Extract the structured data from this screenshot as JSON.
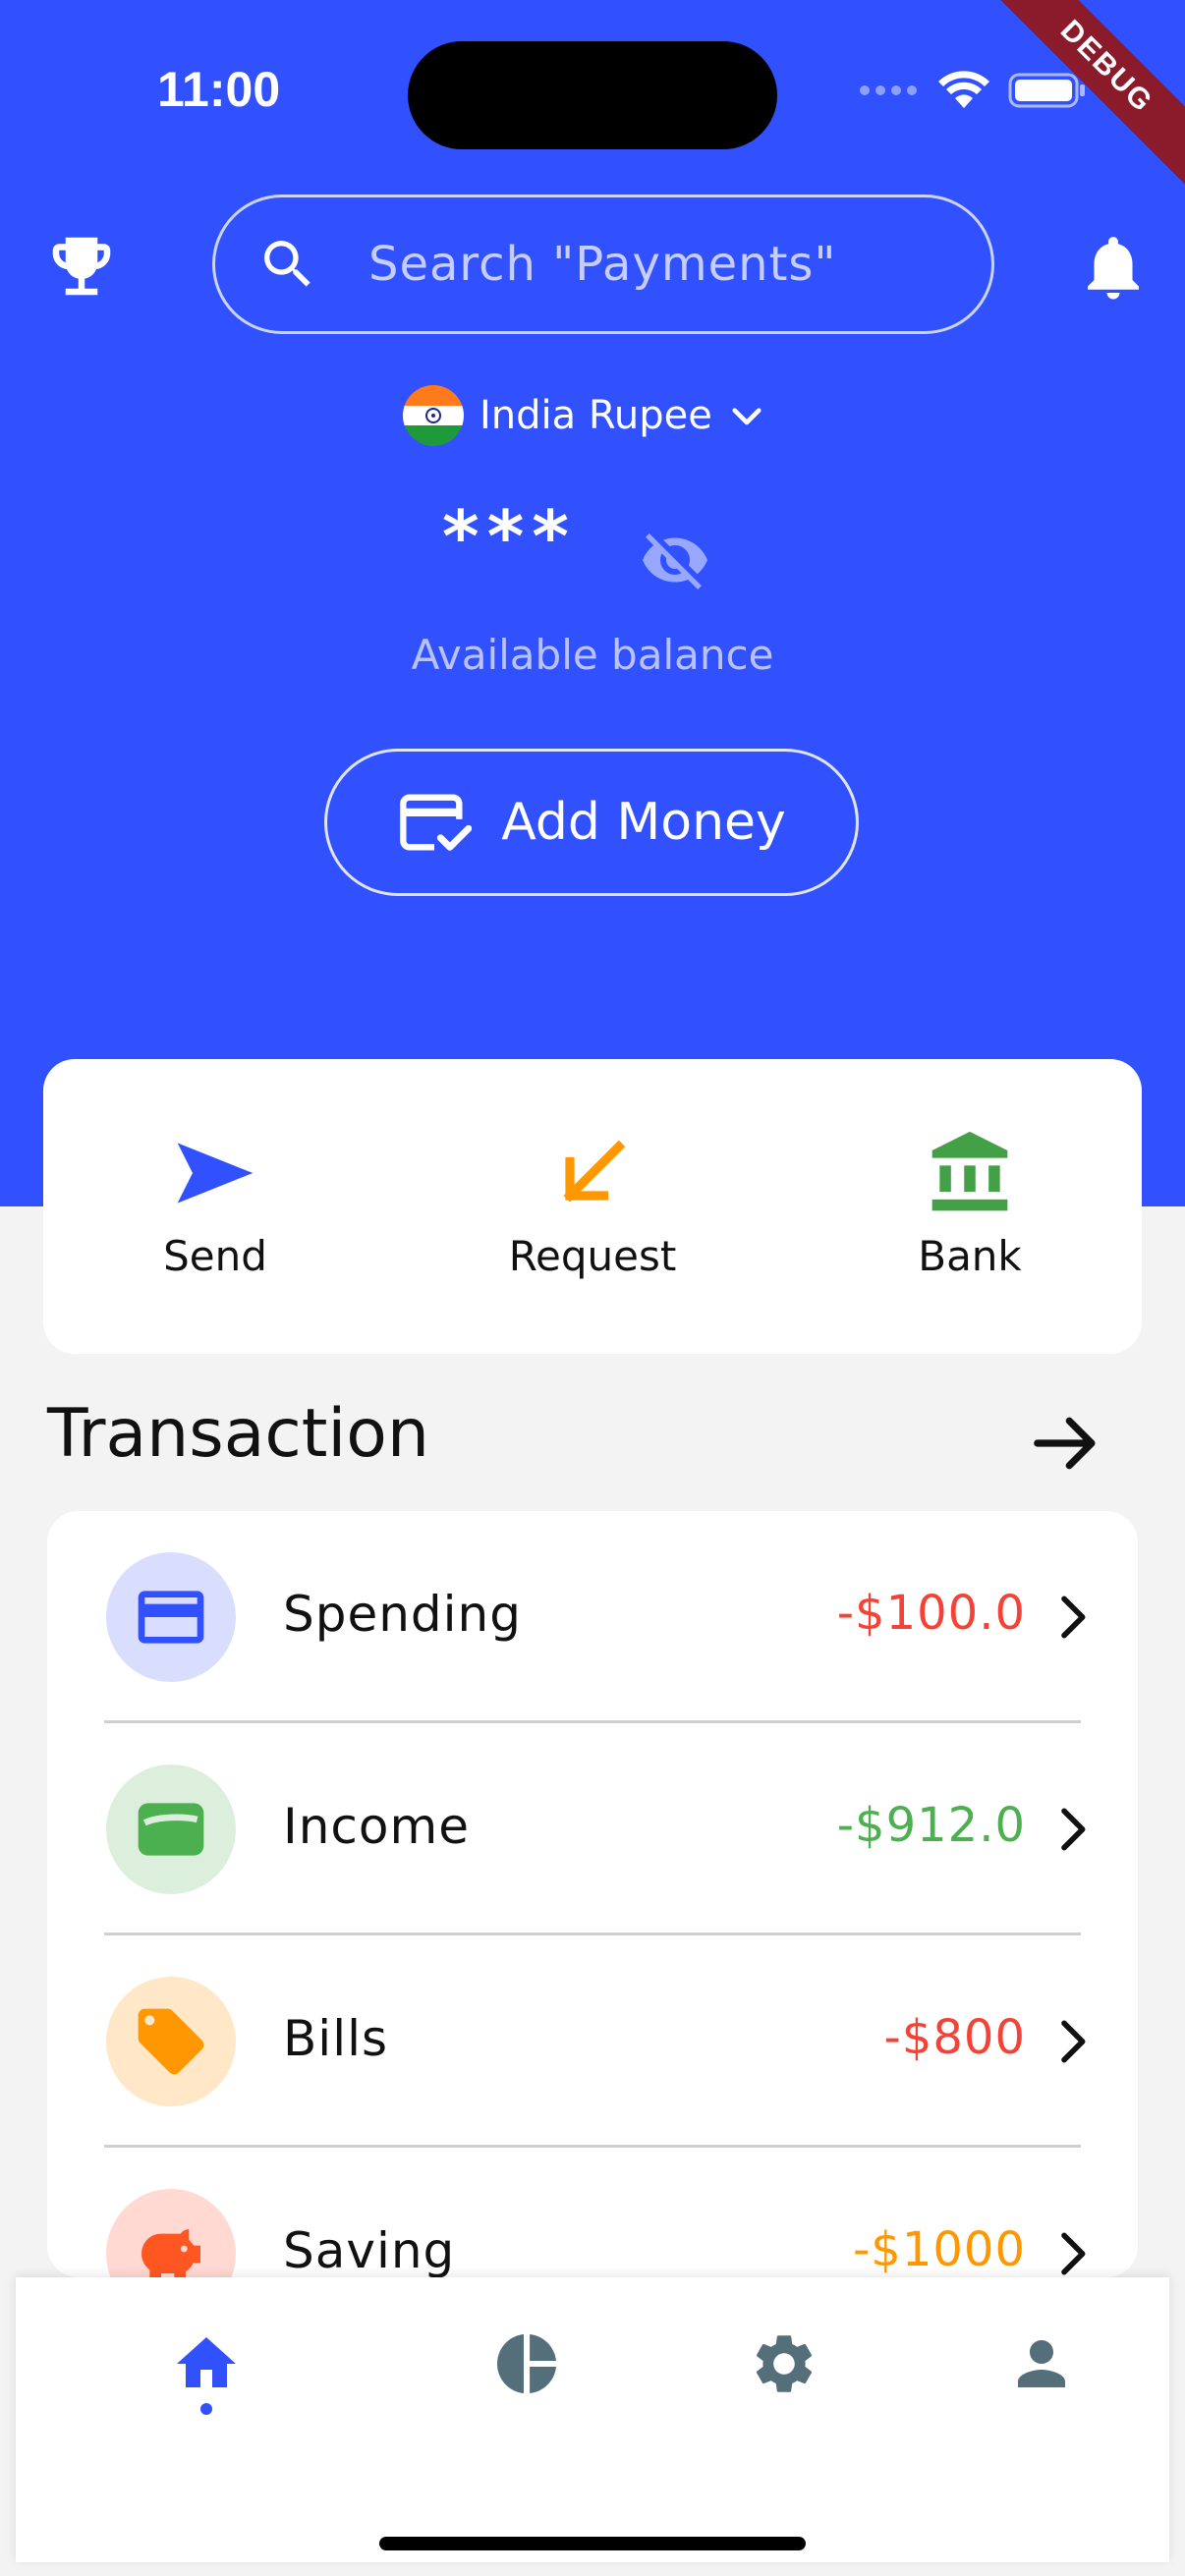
{
  "status_bar": {
    "time": "11:00",
    "debug_label": "DEBUG"
  },
  "header": {
    "search_placeholder": "Search \"Payments\""
  },
  "currency": {
    "label": "India Rupee"
  },
  "balance": {
    "masked_value": "***",
    "caption": "Available balance"
  },
  "add_money": {
    "label": "Add Money"
  },
  "quick_actions": [
    {
      "label": "Send",
      "icon": "send-icon",
      "color": "#3151ff"
    },
    {
      "label": "Request",
      "icon": "arrow-down-left-icon",
      "color": "#ff9800"
    },
    {
      "label": "Bank",
      "icon": "bank-icon",
      "color": "#43a047"
    }
  ],
  "transactions": {
    "title": "Transaction",
    "items": [
      {
        "name": "Spending",
        "amount": "-$100.0",
        "amount_color": "#f44336",
        "icon": "credit-card-icon",
        "icon_bg": "#d9deff",
        "icon_color": "#3151ff"
      },
      {
        "name": "Income",
        "amount": "-$912.0",
        "amount_color": "#4caf50",
        "icon": "wallet-icon",
        "icon_bg": "#dcefdc",
        "icon_color": "#4caf50"
      },
      {
        "name": "Bills",
        "amount": "-$800",
        "amount_color": "#f44336",
        "icon": "tag-icon",
        "icon_bg": "#ffe7c7",
        "icon_color": "#ff9800"
      },
      {
        "name": "Saving",
        "amount": "-$1000",
        "amount_color": "#ff9800",
        "icon": "piggy-bank-icon",
        "icon_bg": "#ffd9d2",
        "icon_color": "#ff5722"
      }
    ]
  },
  "bottom_nav": [
    {
      "name": "home",
      "icon": "home-icon",
      "active": true
    },
    {
      "name": "analytics",
      "icon": "pie-chart-icon",
      "active": false
    },
    {
      "name": "settings",
      "icon": "gear-icon",
      "active": false
    },
    {
      "name": "profile",
      "icon": "person-icon",
      "active": false
    }
  ],
  "colors": {
    "primary": "#3151ff",
    "background": "#f3f3f3",
    "nav_inactive": "#546e7a"
  }
}
